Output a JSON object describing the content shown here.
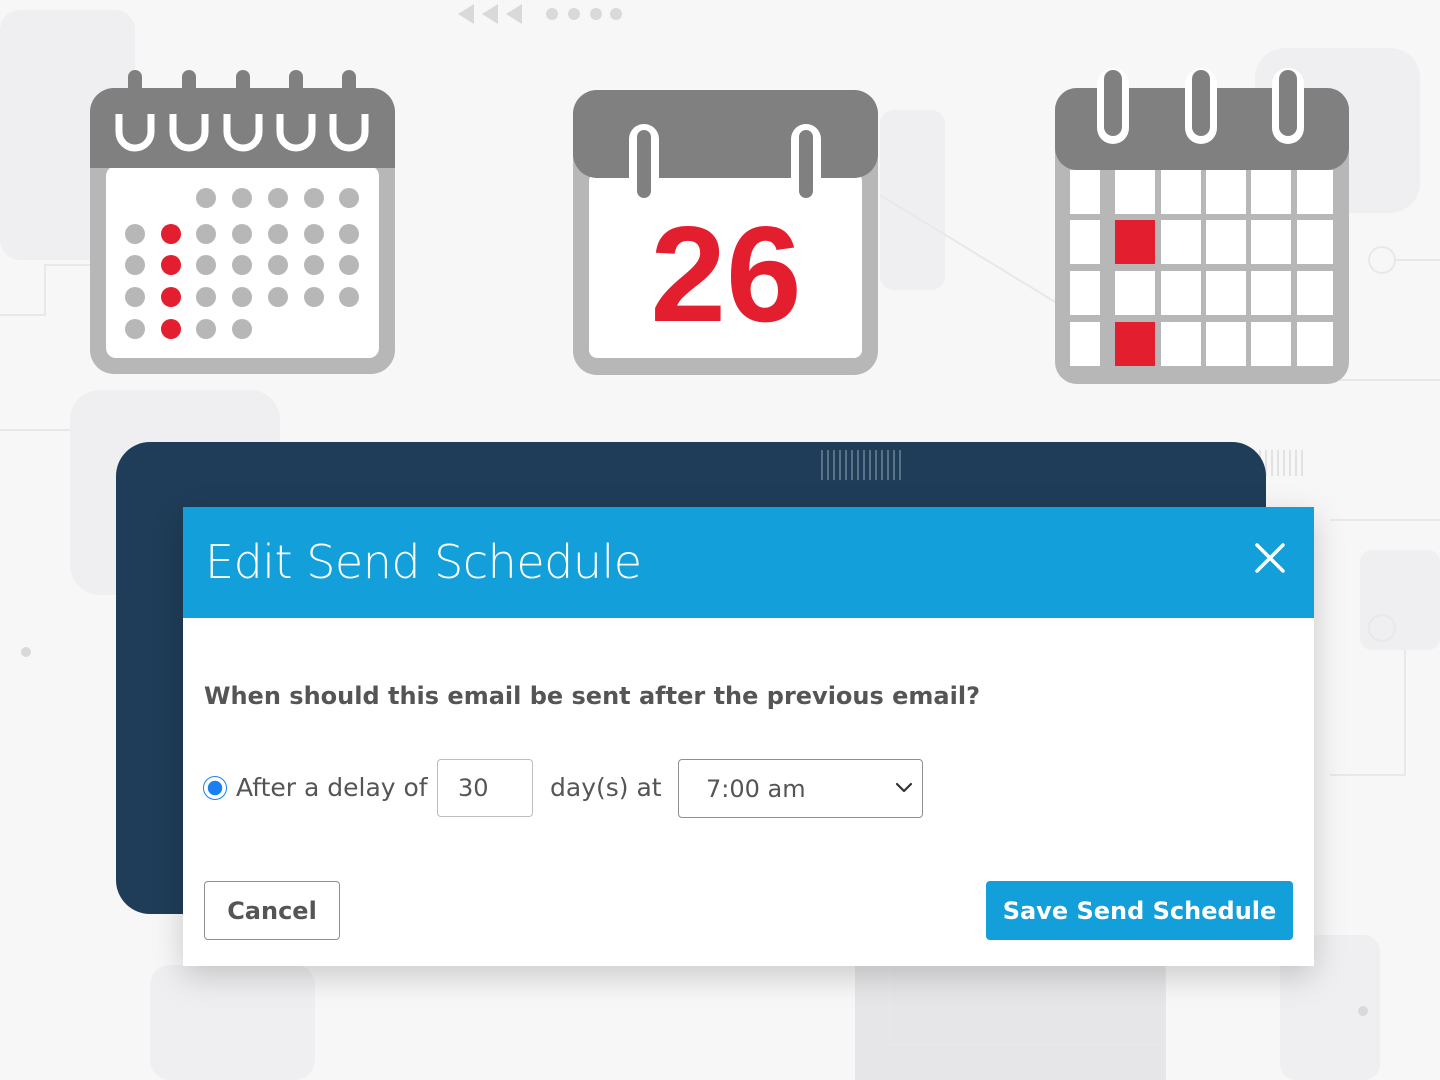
{
  "hero": {
    "calendar_date_number": "26",
    "accent_red": "#e31e2f",
    "icon_gray": "#808080"
  },
  "dialog": {
    "title": "Edit Send Schedule",
    "close_icon": "close-icon",
    "question": "When should this email be sent after the previous email?",
    "radio_selected": true,
    "delay_label": "After a delay of",
    "delay_value": "30",
    "days_label": "day(s) at",
    "time_selected": "7:00 am",
    "cancel_label": "Cancel",
    "save_label": "Save Send Schedule",
    "header_color": "#129fda",
    "backdrop_color": "#1f3d58"
  }
}
